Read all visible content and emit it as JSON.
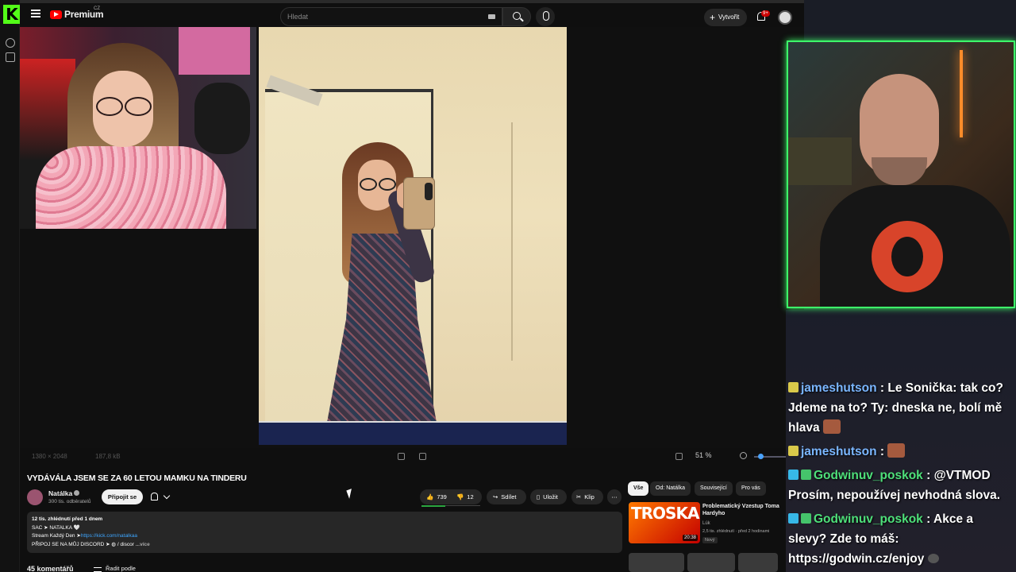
{
  "header": {
    "brand": "Premium",
    "brand_region": "CZ",
    "search_placeholder": "Hledat",
    "create_label": "Vytvořit",
    "notifications_badge": "9+"
  },
  "viewer": {
    "dimensions": "1380 × 2048",
    "file_size": "187,8 kB",
    "zoom": "51 %"
  },
  "video": {
    "title": "VYDÁVÁLA JSEM SE ZA 60 LETOU MAMKU NA TINDERU",
    "channel": "Natálka",
    "subscribers": "300 tis. odběratelů",
    "join_label": "Připojit se",
    "likes": "739",
    "dislikes": "12",
    "share_label": "Sdílet",
    "save_label": "Uložit",
    "clip_label": "Klip",
    "description": {
      "meta": "12 tis. zhlédnutí  před 1 dnem",
      "line1": "SAC ➤ NATALKA 🤍",
      "line2_prefix": "Stream Každý Den ➤",
      "line2_link": "https://kick.com/natalkaa",
      "line3": "PŘIPOJ SE NA MŮJ DISCORD ➤ ◍ / discor",
      "more": "...více"
    },
    "comments_count": "45 komentářů",
    "sort_label": "Řadit podle"
  },
  "related": {
    "chips": [
      "Vše",
      "Od: Natálka",
      "Související",
      "Pro vás"
    ],
    "items": [
      {
        "thumb_text": "TROSKA",
        "duration": "20:38",
        "title": "Problematický Vzestup Toma Hardyho",
        "channel": "Lúk",
        "meta": "2,5 tis. zhlédnutí · před 2 hodinami",
        "badge": "Nový"
      }
    ]
  },
  "chat": {
    "messages": [
      {
        "user": "jameshutson",
        "text": " : Le Sonička: tak co? Jdeme na to? Ty: dneska ne, bolí mě hlava",
        "user_color": "#7ab6ff"
      },
      {
        "user": "jameshutson",
        "text": " : ",
        "user_color": "#7ab6ff"
      },
      {
        "user": "Godwinuv_poskok",
        "text": " : @VTMOD Prosím, nepoužívej nevhodná slova.",
        "user_color": "#4ee07a"
      },
      {
        "user": "Godwinuv_poskok",
        "text": " : Akce a slevy? Zde to máš: https://godwin.cz/enjoy",
        "user_color": "#4ee07a"
      }
    ]
  },
  "colors": {
    "kick_green": "#53fc18",
    "yt_red": "#ff0000",
    "link_blue": "#3ea6ff",
    "webcam_border": "#3dff6a"
  }
}
